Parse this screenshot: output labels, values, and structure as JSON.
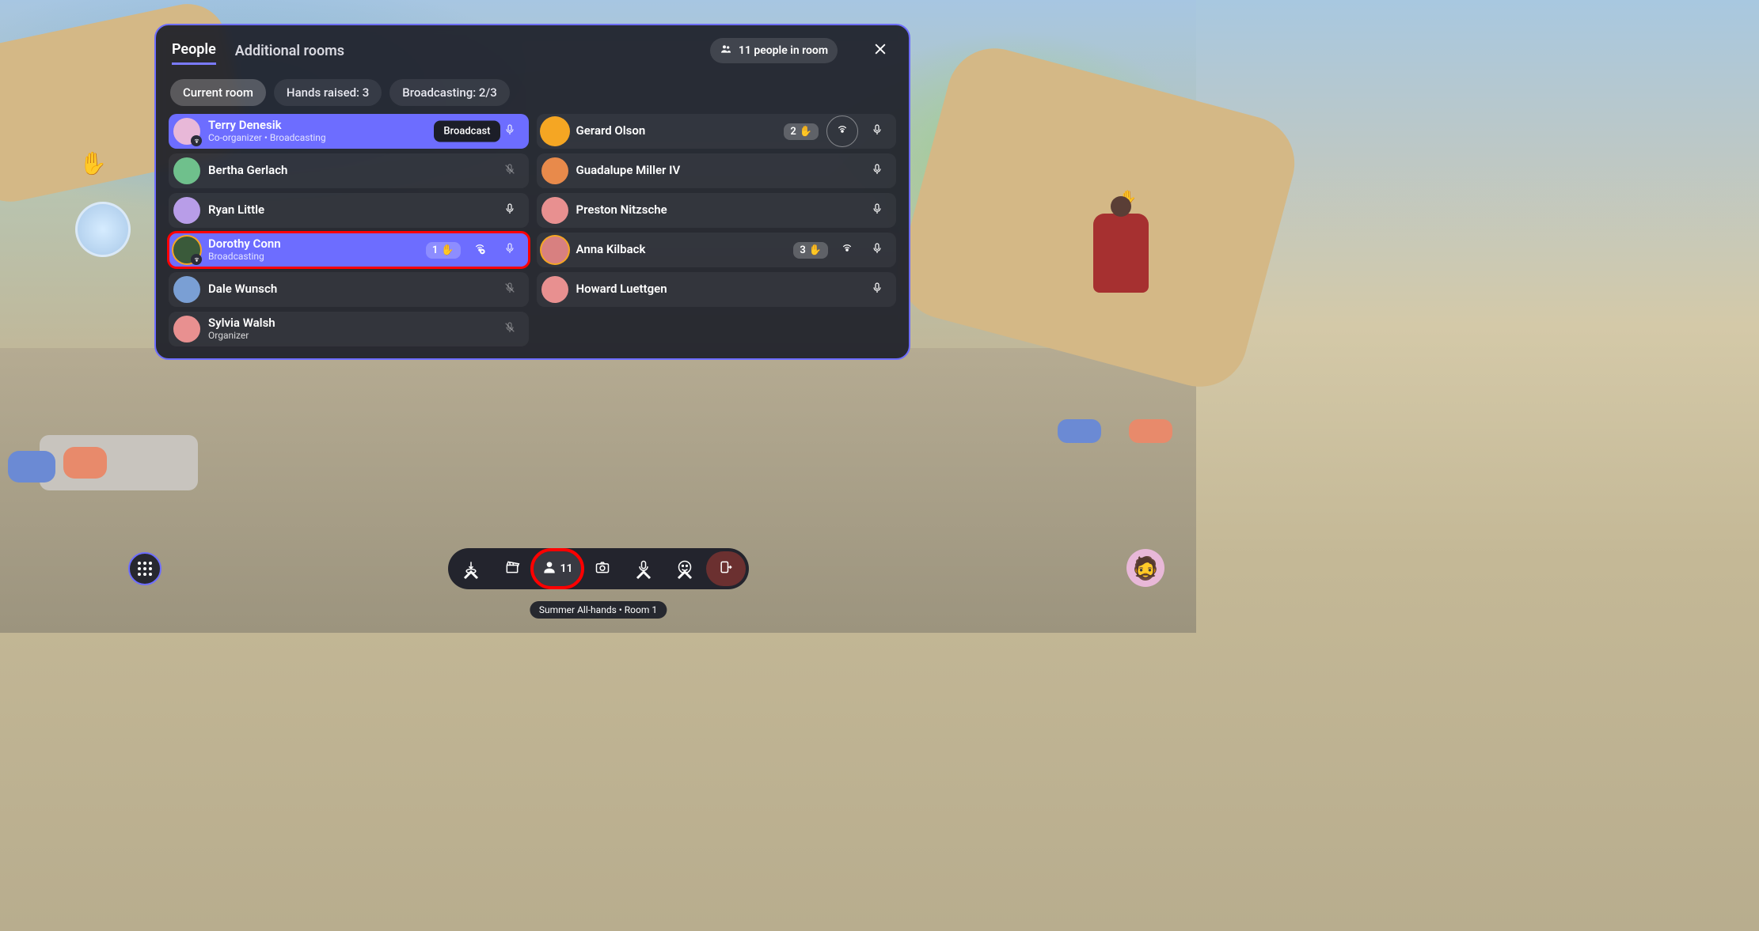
{
  "header": {
    "tab_people": "People",
    "tab_additional": "Additional rooms",
    "room_count_label": "11 people in room"
  },
  "filters": {
    "current_room": "Current room",
    "hands_raised": "Hands raised: 3",
    "broadcasting": "Broadcasting: 2/3"
  },
  "tooltip": {
    "broadcast": "Broadcast"
  },
  "people": {
    "left": [
      {
        "name": "Terry Denesik",
        "subtitle": "Co-organizer • Broadcasting",
        "avatar_bg": "#e8b8d8",
        "broadcasting": true,
        "mic": "light",
        "badge": true
      },
      {
        "name": "Gerard Olson",
        "avatar_bg": "#f5a623",
        "ring": "orange",
        "hand": "2",
        "broadcast_btn": true,
        "mic": "active"
      },
      {
        "name": "Bertha Gerlach",
        "avatar_bg": "#6fc08c",
        "mic": "muted"
      },
      {
        "name": "Guadalupe Miller IV",
        "avatar_bg": "#e88a4b",
        "mic": "active"
      },
      {
        "name": "Ryan Little",
        "avatar_bg": "#b89de8",
        "mic": "active"
      },
      {
        "name": "Preston Nitzsche",
        "avatar_bg": "#e89090",
        "mic": "active"
      }
    ],
    "right": [
      {
        "name": "Dorothy Conn",
        "subtitle": "Broadcasting",
        "avatar_bg": "#3a5a3a",
        "ring": "orange",
        "broadcasting": true,
        "hand": "1",
        "broadcast_x": true,
        "mic": "light",
        "badge": true,
        "red_box": true
      },
      {
        "name": "Anna Kilback",
        "avatar_bg": "#d88080",
        "ring": "orange",
        "hand": "3",
        "broadcast_icon": true,
        "mic": "active"
      },
      {
        "name": "Dale Wunsch",
        "avatar_bg": "#7a9fd4",
        "mic": "muted"
      },
      {
        "name": "Howard Luettgen",
        "avatar_bg": "#e89090",
        "mic": "active"
      },
      {
        "name": "Sylvia Walsh",
        "subtitle": "Organizer",
        "avatar_bg": "#e89090",
        "mic": "muted"
      }
    ]
  },
  "toolbar": {
    "people_count": "11"
  },
  "session": {
    "label": "Summer All-hands • Room 1"
  }
}
